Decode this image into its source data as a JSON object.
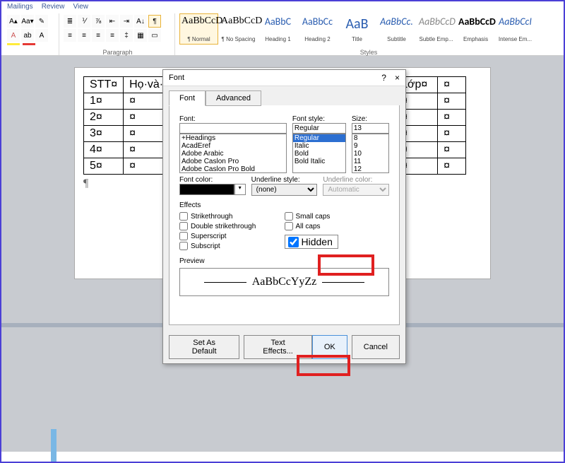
{
  "ribbon": {
    "tabs": [
      "Mailings",
      "Review",
      "View"
    ],
    "paragraph_label": "Paragraph",
    "styles_label": "Styles",
    "styles": [
      {
        "preview": "AaBbCcD",
        "label": "¶ Normal",
        "selected": true,
        "serif": true
      },
      {
        "preview": "AaBbCcD",
        "label": "¶ No Spacing",
        "serif": true
      },
      {
        "preview": "AaBbC",
        "label": "Heading 1",
        "color": "#2a5db0"
      },
      {
        "preview": "AaBbCc",
        "label": "Heading 2",
        "color": "#2a5db0"
      },
      {
        "preview": "AaB",
        "label": "Title",
        "color": "#2a5db0",
        "big": true
      },
      {
        "preview": "AaBbCc.",
        "label": "Subtitle",
        "italic": true,
        "color": "#2a5db0"
      },
      {
        "preview": "AaBbCcD",
        "label": "Subtle Emp...",
        "italic": true,
        "color": "#888"
      },
      {
        "preview": "AaBbCcD",
        "label": "Emphasis",
        "bold": true
      },
      {
        "preview": "AaBbCcI",
        "label": "Intense Em...",
        "italic": true,
        "color": "#2a5db0"
      }
    ]
  },
  "table": {
    "headers": [
      "STT¤",
      "Họ·và·",
      "Lớp¤"
    ],
    "rows": [
      [
        "1¤",
        "¤",
        "¤"
      ],
      [
        "2¤",
        "¤",
        "¤"
      ],
      [
        "3¤",
        "¤",
        "¤"
      ],
      [
        "4¤",
        "¤",
        "¤"
      ],
      [
        "5¤",
        "¤",
        "¤"
      ]
    ]
  },
  "dialog": {
    "title": "Font",
    "help": "?",
    "close": "×",
    "tabs": {
      "font": "Font",
      "advanced": "Advanced"
    },
    "labels": {
      "font": "Font:",
      "style": "Font style:",
      "size": "Size:",
      "color": "Font color:",
      "ustyle": "Underline style:",
      "ucolor": "Underline color:",
      "effects": "Effects",
      "preview": "Preview"
    },
    "font_value": "",
    "fonts": [
      "+Headings",
      "AcadEref",
      "Adobe Arabic",
      "Adobe Caslon Pro",
      "Adobe Caslon Pro Bold"
    ],
    "style_value": "Regular",
    "styles": [
      "Regular",
      "Italic",
      "Bold",
      "Bold Italic"
    ],
    "size_value": "13",
    "sizes": [
      "8",
      "9",
      "10",
      "11",
      "12"
    ],
    "ustyle_value": "(none)",
    "ucolor_value": "Automatic",
    "effects": {
      "strike": "Strikethrough",
      "dstrike": "Double strikethrough",
      "super": "Superscript",
      "sub": "Subscript",
      "small": "Small caps",
      "all": "All caps",
      "hidden": "Hidden"
    },
    "preview_text": "AaBbCcYyZz",
    "buttons": {
      "setdef": "Set As Default",
      "texteff": "Text Effects...",
      "ok": "OK",
      "cancel": "Cancel"
    }
  }
}
